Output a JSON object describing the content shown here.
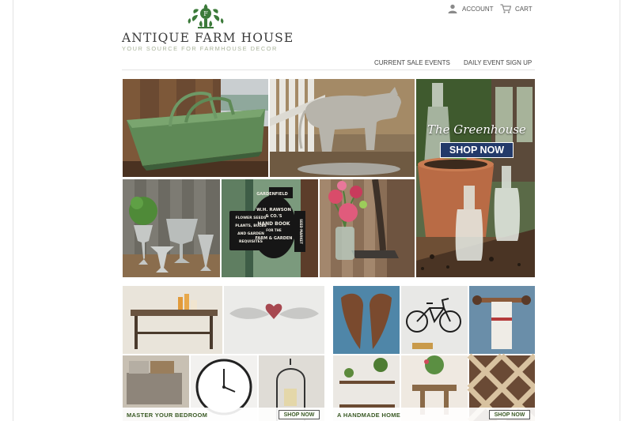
{
  "brand": {
    "name": "ANTIQUE FARM HOUSE",
    "tagline": "YOUR SOURCE FOR FARMHOUSE DECOR",
    "emblem_icon": "leaf-crest-icon",
    "colors": {
      "green": "#3c7a3a",
      "tagline": "#a9b39a"
    }
  },
  "header": {
    "account": {
      "label": "ACCOUNT",
      "icon": "user-icon"
    },
    "cart": {
      "label": "CART",
      "icon": "cart-icon"
    }
  },
  "nav": {
    "items": [
      {
        "label": "CURRENT SALE EVENTS"
      },
      {
        "label": "DAILY EVENT SIGN UP"
      }
    ]
  },
  "hero": {
    "sign_lines": [
      "GARDENFIELD",
      "W.H. RAWSON",
      "& CO.'S",
      "HAND BOOK",
      "FOR THE",
      "FARM & GARDEN",
      "FLOWER SEEDS",
      "PLANTS, BULBS",
      "AND GARDEN",
      "REQUISITES",
      "SEED MARKET"
    ],
    "greenhouse": {
      "title": "The Greenhouse",
      "button": "SHOP NOW",
      "button_color": "#233a6a"
    }
  },
  "banners": [
    {
      "label": "MASTER YOUR BEDROOM",
      "button": "SHOP NOW"
    },
    {
      "label": "A HANDMADE HOME",
      "button": "SHOP NOW"
    }
  ]
}
